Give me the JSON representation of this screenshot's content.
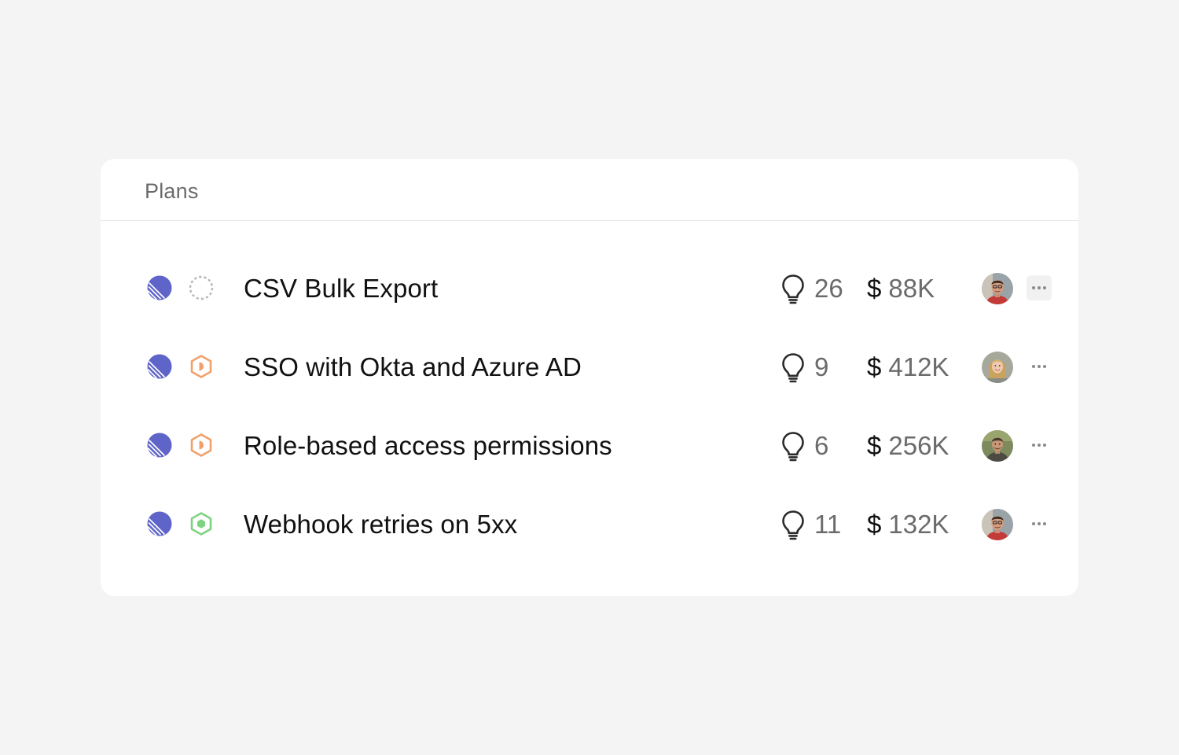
{
  "panel": {
    "title": "Plans"
  },
  "colors": {
    "team": "#5e64c8",
    "status_backlog": "#b5b5b5",
    "status_in_progress": "#f0a06b",
    "status_done": "#7ed381"
  },
  "rows": [
    {
      "title": "CSV Bulk Export",
      "team_icon": "team-striped-circle-icon",
      "status": "backlog",
      "status_icon": "dashed-circle-icon",
      "ideas_icon": "lightbulb-icon",
      "ideas": "26",
      "currency": "$",
      "revenue": "88K",
      "avatar": "avatar-man-red-shirt",
      "menu_icon": "more-icon"
    },
    {
      "title": "SSO with Okta and Azure AD",
      "team_icon": "team-striped-circle-icon",
      "status": "in-progress",
      "status_icon": "hexagon-play-icon",
      "ideas_icon": "lightbulb-icon",
      "ideas": "9",
      "currency": "$",
      "revenue": "412K",
      "avatar": "avatar-woman-blonde",
      "menu_icon": "more-icon"
    },
    {
      "title": "Role-based access permissions",
      "team_icon": "team-striped-circle-icon",
      "status": "in-progress",
      "status_icon": "hexagon-play-icon",
      "ideas_icon": "lightbulb-icon",
      "ideas": "6",
      "currency": "$",
      "revenue": "256K",
      "avatar": "avatar-man-outdoor",
      "menu_icon": "more-icon"
    },
    {
      "title": "Webhook retries on 5xx",
      "team_icon": "team-striped-circle-icon",
      "status": "done",
      "status_icon": "hexagon-dot-icon",
      "ideas_icon": "lightbulb-icon",
      "ideas": "11",
      "currency": "$",
      "revenue": "132K",
      "avatar": "avatar-man-red-shirt",
      "menu_icon": "more-icon"
    }
  ]
}
